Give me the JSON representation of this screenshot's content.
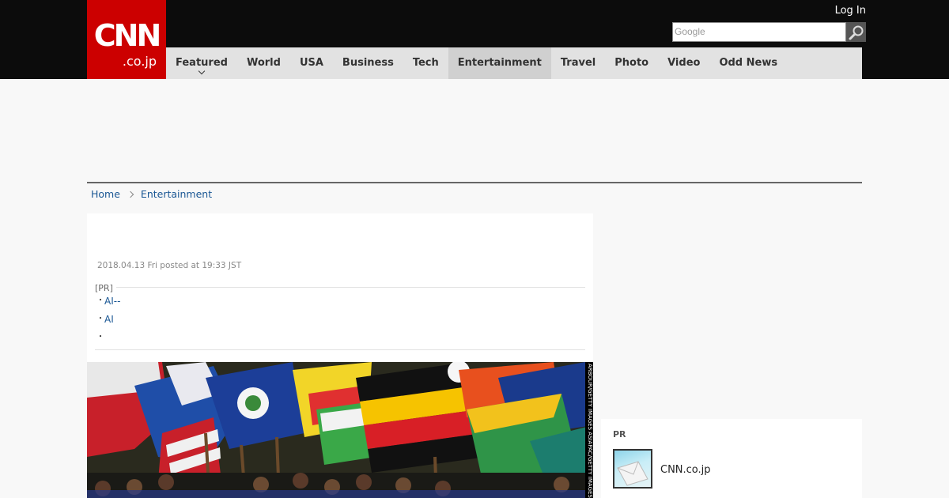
{
  "header": {
    "logo_main": "CNN",
    "logo_sub": ".co.jp",
    "login_label": "Log In",
    "search_placeholder": "Google",
    "nav": [
      {
        "label": "Featured",
        "has_dropdown": true
      },
      {
        "label": "World"
      },
      {
        "label": "USA"
      },
      {
        "label": "Business"
      },
      {
        "label": "Tech"
      },
      {
        "label": "Entertainment",
        "active": true
      },
      {
        "label": "Travel"
      },
      {
        "label": "Photo"
      },
      {
        "label": "Video"
      },
      {
        "label": "Odd News"
      }
    ]
  },
  "breadcrumb": {
    "home": "Home",
    "section": "Entertainment"
  },
  "article": {
    "date": "2018.04.13 Fri posted at 19:33 JST",
    "pr_label": "[PR]",
    "pr_items": [
      "AI--",
      "AI",
      ""
    ],
    "pr_bullet": "・",
    "photo_credit": "ARBOUR/GETTY IMAGES ASIAPAC/GETTY IMAGES"
  },
  "sidebar": {
    "pr_title": "PR",
    "pr_item": "CNN.co.jp"
  },
  "colors": {
    "brand_red": "#cc0000",
    "link_blue": "#1a5794",
    "header_black": "#0c0c0c",
    "nav_gray": "#e2e2e2"
  }
}
